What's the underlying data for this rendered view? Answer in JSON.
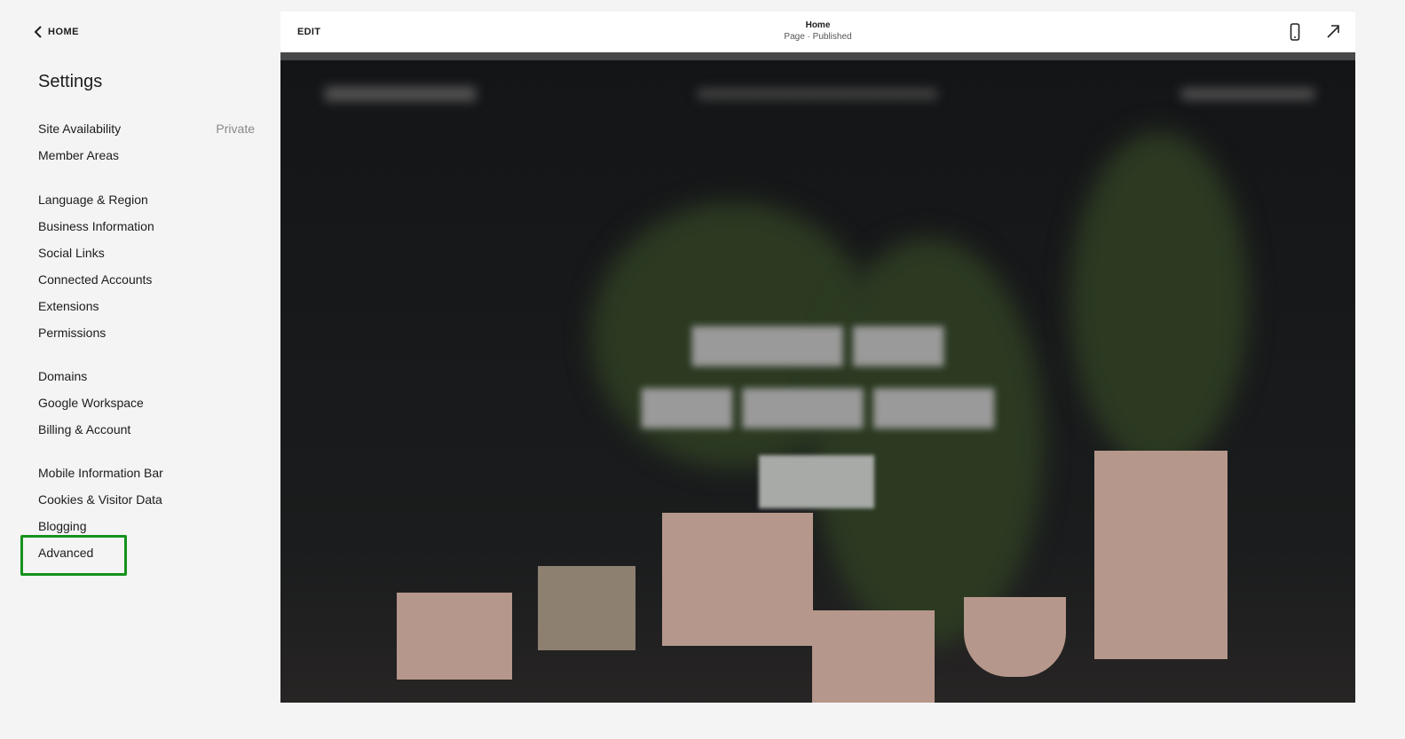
{
  "sidebar": {
    "back_label": "HOME",
    "title": "Settings",
    "items": [
      {
        "label": "Site Availability",
        "value": "Private"
      },
      {
        "label": "Member Areas"
      },
      {
        "label": "Language & Region"
      },
      {
        "label": "Business Information"
      },
      {
        "label": "Social Links"
      },
      {
        "label": "Connected Accounts"
      },
      {
        "label": "Extensions"
      },
      {
        "label": "Permissions"
      },
      {
        "label": "Domains"
      },
      {
        "label": "Google Workspace"
      },
      {
        "label": "Billing & Account"
      },
      {
        "label": "Mobile Information Bar"
      },
      {
        "label": "Cookies & Visitor Data"
      },
      {
        "label": "Blogging"
      },
      {
        "label": "Advanced"
      }
    ],
    "highlighted": "Advanced",
    "highlight_color": "#14921c"
  },
  "preview": {
    "edit_label": "EDIT",
    "page_title": "Home",
    "page_status": "Page · Published",
    "icons": [
      "mobile-icon",
      "open-external-icon"
    ]
  }
}
